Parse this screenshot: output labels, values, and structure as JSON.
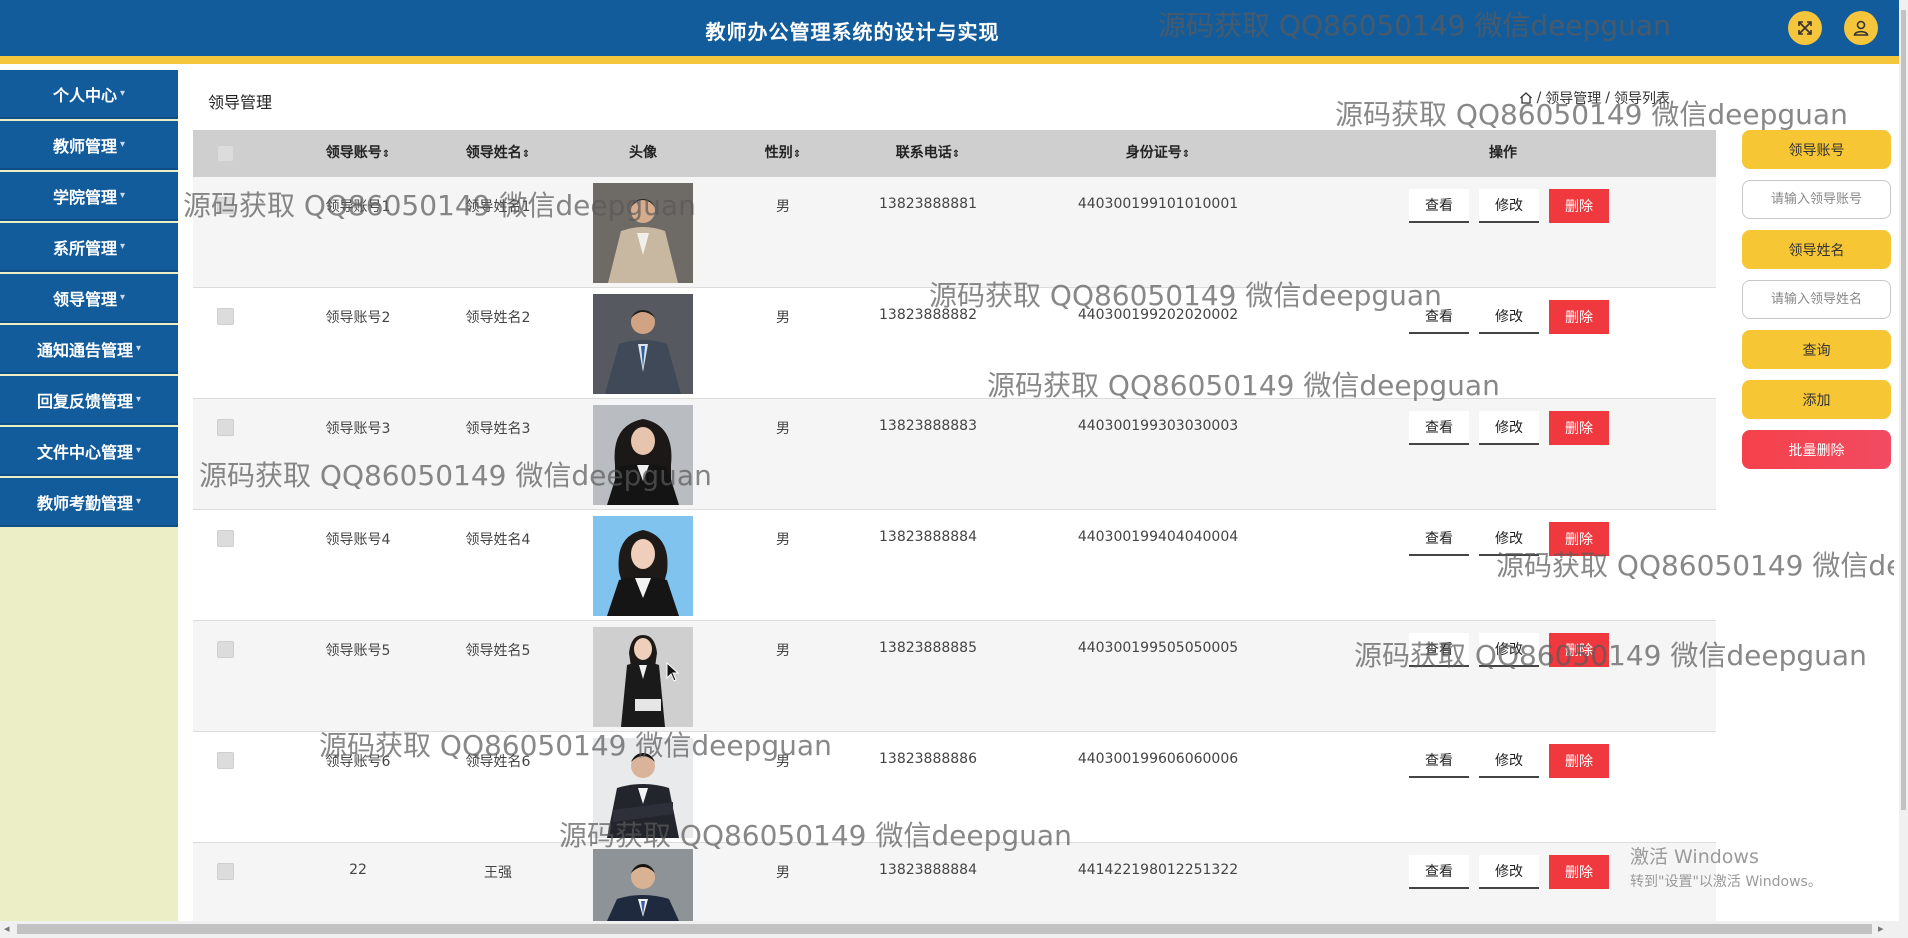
{
  "app": {
    "title": "教师办公管理系统的设计与实现"
  },
  "header": {
    "fullscreen_icon": "expand-icon",
    "user_icon": "user-icon"
  },
  "sidebar": {
    "items": [
      {
        "label": "个人中心"
      },
      {
        "label": "教师管理"
      },
      {
        "label": "学院管理"
      },
      {
        "label": "系所管理"
      },
      {
        "label": "领导管理"
      },
      {
        "label": "通知通告管理"
      },
      {
        "label": "回复反馈管理"
      },
      {
        "label": "文件中心管理"
      },
      {
        "label": "教师考勤管理"
      }
    ]
  },
  "page": {
    "title": "领导管理"
  },
  "breadcrumb": {
    "home_icon": "home-icon",
    "sep": "/",
    "level1": "领导管理",
    "level2": "领导列表"
  },
  "table": {
    "headers": {
      "account": "领导账号",
      "name": "领导姓名",
      "avatar": "头像",
      "gender": "性别",
      "phone": "联系电话",
      "idcard": "身份证号",
      "actions": "操作",
      "sort_icon": "⇕"
    },
    "rows": [
      {
        "account": "领导账号1",
        "name": "领导姓名1",
        "gender": "男",
        "phone": "13823888881",
        "idcard": "440300199101010001"
      },
      {
        "account": "领导账号2",
        "name": "领导姓名2",
        "gender": "男",
        "phone": "13823888882",
        "idcard": "440300199202020002"
      },
      {
        "account": "领导账号3",
        "name": "领导姓名3",
        "gender": "男",
        "phone": "13823888883",
        "idcard": "440300199303030003"
      },
      {
        "account": "领导账号4",
        "name": "领导姓名4",
        "gender": "男",
        "phone": "13823888884",
        "idcard": "440300199404040004"
      },
      {
        "account": "领导账号5",
        "name": "领导姓名5",
        "gender": "男",
        "phone": "13823888885",
        "idcard": "440300199505050005"
      },
      {
        "account": "领导账号6",
        "name": "领导姓名6",
        "gender": "男",
        "phone": "13823888886",
        "idcard": "440300199606060006"
      },
      {
        "account": "22",
        "name": "王强",
        "gender": "男",
        "phone": "13823888884",
        "idcard": "441422198012251322"
      }
    ],
    "btn_view": "查看",
    "btn_edit": "修改",
    "btn_delete": "删除"
  },
  "search": {
    "account_label": "领导账号",
    "account_placeholder": "请输入领导账号",
    "name_label": "领导姓名",
    "name_placeholder": "请输入领导姓名",
    "query_btn": "查询",
    "add_btn": "添加",
    "batch_delete_btn": "批量删除"
  },
  "watermark": {
    "text": "源码获取 QQ86050149 微信deepguan"
  },
  "windows_activation": {
    "line1": "激活 Windows",
    "line2": "转到\"设置\"以激活 Windows。"
  },
  "colors": {
    "header": "#135c9c",
    "accent": "#f5c63c",
    "danger": "#f0383f",
    "sidebar_bg": "#ecefc5"
  }
}
